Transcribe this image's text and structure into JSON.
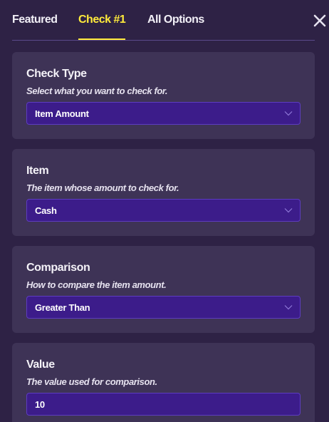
{
  "tabs": [
    {
      "label": "Featured"
    },
    {
      "label": "Check #1"
    },
    {
      "label": "All Options"
    }
  ],
  "active_tab": "Check #1",
  "accent_color": "#ffeb3b",
  "close_icon": "close-icon",
  "sections": [
    {
      "title": "Check Type",
      "description": "Select what you want to check for.",
      "value": "Item Amount",
      "control": "dropdown"
    },
    {
      "title": "Item",
      "description": "The item whose amount to check for.",
      "value": "Cash",
      "control": "dropdown"
    },
    {
      "title": "Comparison",
      "description": "How to compare the item amount.",
      "value": "Greater Than",
      "control": "dropdown"
    },
    {
      "title": "Value",
      "description": "The value used for comparison.",
      "value": "10",
      "control": "number-input"
    }
  ]
}
